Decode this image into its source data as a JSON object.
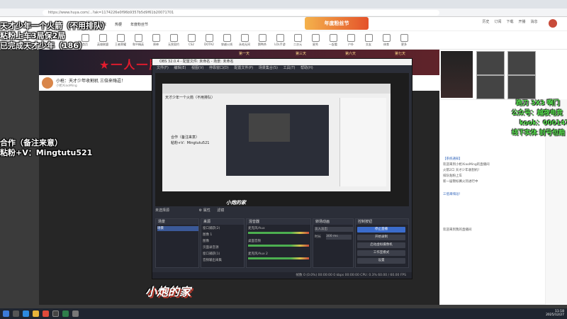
{
  "browser": {
    "url": "https://www.huya.com/...?ak=1174226e0f96b9357b5d9f61b20071701"
  },
  "site_header": {
    "nav": [
      "游戏",
      "热梗",
      "年度粉丝节"
    ],
    "banner": "年度粉丝节",
    "icons": [
      "历史",
      "订阅",
      "下载",
      "开播",
      "消息"
    ]
  },
  "categories": [
    "首页",
    "英雄联盟",
    "王者荣耀",
    "和平精英",
    "原神",
    "无畏契约",
    "CS2",
    "DOTA2",
    "穿越火线",
    "永劫无间",
    "鹅鸭杀",
    "LOL手游",
    "二次元",
    "星秀",
    "一起看",
    "户外",
    "交友",
    "体育",
    "更多"
  ],
  "room": {
    "banner_text": "★一人一服★",
    "days": [
      "第一天",
      "第三天",
      "第六天",
      "第七天"
    ],
    "title": "小枪：天才少年收割机 三倍来嗨逗！",
    "streamer": "小枪XiaoMing"
  },
  "overlay_left": {
    "line1": "天才少年一个火箭（不用排队）",
    "line2": "粘粉上车3局保2局",
    "line3": "已完成天才少年（186）",
    "line4": "合作（备注来意）",
    "line5": "粘粉+V：Mingtutu521"
  },
  "overlay_right": {
    "line1": "跑刀 3X3 啊门",
    "line2": "公众号：越夜电竞",
    "line3": "kook：000147",
    "line4": "线下实体 封号包赔"
  },
  "brand": "小炮的家",
  "obs": {
    "title": "OBS 32.0.4 - 配置文件: 未命名 - 场景: 未命名",
    "menu": [
      "文件(F)",
      "编辑(E)",
      "视图(V)",
      "停靠窗口(D)",
      "配置文件(P)",
      "场景集合(S)",
      "工具(T)",
      "帮助(H)"
    ],
    "source_selected": "未选择源",
    "props_label": "属性",
    "filter_label": "滤镜",
    "docks": {
      "scenes": {
        "title": "场景",
        "items": [
          "场景"
        ]
      },
      "sources": {
        "title": "来源",
        "items": [
          "窗口捕获(2)",
          "图像 1",
          "图像",
          "页面录音源",
          "窗口捕获(1)",
          "音频输出采集"
        ]
      },
      "mixer": {
        "title": "混音器",
        "items": [
          "麦克风/Aux",
          "桌面音频",
          "麦克风/Aux 2"
        ]
      },
      "transitions": {
        "title": "转场动画",
        "fade": "淡入淡出",
        "duration_label": "时长",
        "duration": "300 ms"
      },
      "controls": {
        "title": "控制按钮",
        "buttons": [
          "停止直播",
          "开始录制",
          "启动虚拟摄像机",
          "工作室模式",
          "设置"
        ]
      }
    },
    "status": "帧数 0 (0.0%)   00:00:00   0 kbps   00:00:00   CPU: 0.3%   60.00 / 60.00 FPS"
  },
  "nested_overlay": {
    "line1": "合作（备注来意）",
    "line2": "粘粉+V：Mingtutu521",
    "logo": "小炮的家"
  },
  "chat": {
    "lines": [
      "【系统通知】",
      "欢迎来到小枪XiaoMing的直播间",
      "火箭2口 天才少年收割机！",
      "排队粘粉上车",
      "新一届锦标赛火热进行中",
      "三倍来嗨逗！",
      "欢迎来到我的直播间"
    ]
  },
  "taskbar": {
    "time": "11:18",
    "date": "2025/12/27"
  }
}
